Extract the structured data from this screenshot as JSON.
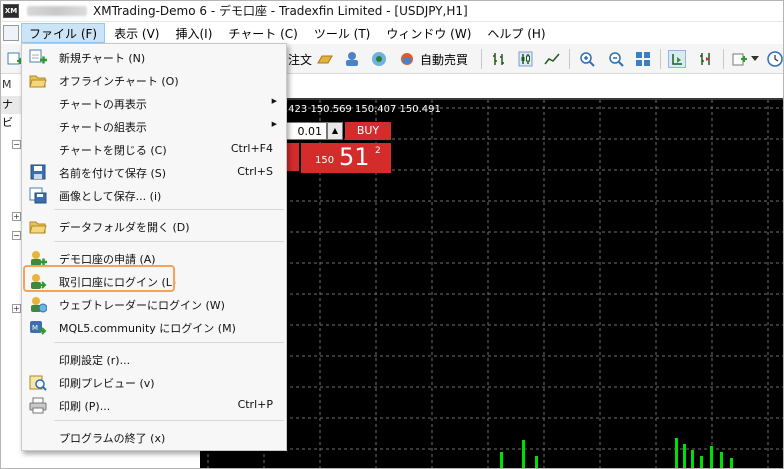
{
  "window": {
    "app_icon_text": "XM",
    "title": "XMTrading-Demo 6 - デモ口座 - Tradexfin Limited - [USDJPY,H1]"
  },
  "menubar": {
    "items": [
      {
        "label": "ファイル (F)",
        "active": true
      },
      {
        "label": "表示 (V)",
        "active": false
      },
      {
        "label": "挿入(I)",
        "active": false
      },
      {
        "label": "チャート (C)",
        "active": false
      },
      {
        "label": "ツール (T)",
        "active": false
      },
      {
        "label": "ウィンドウ (W)",
        "active": false
      },
      {
        "label": "ヘルプ (H)",
        "active": false
      }
    ]
  },
  "toolbar": {
    "order_label_partial": "注文",
    "autotrade_label": "自動売買"
  },
  "leftpanel": {
    "tab_label": "M",
    "header_label": "ナビ"
  },
  "chart": {
    "info_line": ".423 150.569 150.407 150.491",
    "lot_value": "0.01",
    "buy_label": "BUY",
    "price_prefix": "150",
    "price_main": "51",
    "price_sup": "2"
  },
  "file_menu": {
    "items": [
      {
        "label": "新規チャート (N)",
        "shortcut": "",
        "submenu": false,
        "icon": "new-chart-icon"
      },
      {
        "label": "オフラインチャート (O)",
        "shortcut": "",
        "submenu": false,
        "icon": "folder-open-icon"
      },
      {
        "label": "チャートの再表示",
        "shortcut": "",
        "submenu": true,
        "icon": ""
      },
      {
        "label": "チャートの組表示",
        "shortcut": "",
        "submenu": true,
        "icon": ""
      },
      {
        "label": "チャートを閉じる (C)",
        "shortcut": "Ctrl+F4",
        "submenu": false,
        "icon": ""
      },
      {
        "label": "名前を付けて保存 (S)",
        "shortcut": "Ctrl+S",
        "submenu": false,
        "icon": "save-icon"
      },
      {
        "label": "画像として保存... (i)",
        "shortcut": "",
        "submenu": false,
        "icon": "save-image-icon"
      },
      {
        "label": "データフォルダを開く (D)",
        "shortcut": "",
        "submenu": false,
        "icon": "folder-icon"
      },
      {
        "label": "デモ口座の申請 (A)",
        "shortcut": "",
        "submenu": false,
        "icon": "demo-account-icon"
      },
      {
        "label": "取引口座にログイン (L)",
        "shortcut": "",
        "submenu": false,
        "icon": "login-account-icon"
      },
      {
        "label": "ウェブトレーダーにログイン (W)",
        "shortcut": "",
        "submenu": false,
        "icon": "web-trader-icon"
      },
      {
        "label": "MQL5.community にログイン (M)",
        "shortcut": "",
        "submenu": false,
        "icon": "mql5-icon"
      },
      {
        "label": "印刷設定 (r)...",
        "shortcut": "",
        "submenu": false,
        "icon": ""
      },
      {
        "label": "印刷プレビュー (v)",
        "shortcut": "",
        "submenu": false,
        "icon": "print-preview-icon"
      },
      {
        "label": "印刷 (P)...",
        "shortcut": "Ctrl+P",
        "submenu": false,
        "icon": "printer-icon"
      },
      {
        "label": "プログラムの終了 (x)",
        "shortcut": "",
        "submenu": false,
        "icon": ""
      }
    ]
  },
  "colors": {
    "highlight": "#f5a35a",
    "buy": "#d42b2b",
    "menu_active": "#cce4f7",
    "chart_bg": "#000000",
    "candle": "#00e000"
  }
}
